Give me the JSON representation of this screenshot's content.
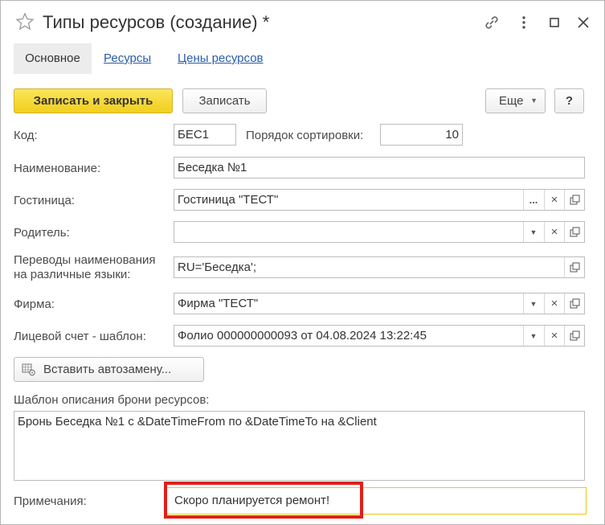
{
  "window": {
    "title": "Типы ресурсов (создание) *"
  },
  "tabs": [
    {
      "label": "Основное"
    },
    {
      "label": "Ресурсы"
    },
    {
      "label": "Цены ресурсов"
    }
  ],
  "toolbar": {
    "save_close_label": "Записать и закрыть",
    "save_label": "Записать",
    "more_label": "Еще",
    "help_label": "?"
  },
  "form": {
    "code": {
      "label": "Код:",
      "value": "БЕС1"
    },
    "sort_order": {
      "label": "Порядок сортировки:",
      "value": "10"
    },
    "name": {
      "label": "Наименование:",
      "value": "Беседка №1"
    },
    "hotel": {
      "label": "Гостиница:",
      "value": "Гостиница \"ТЕСТ\""
    },
    "parent": {
      "label": "Родитель:",
      "value": ""
    },
    "translations": {
      "label_line1": "Переводы наименования",
      "label_line2": "на различные языки:",
      "value": "RU='Беседка';"
    },
    "firm": {
      "label": "Фирма:",
      "value": "Фирма \"ТЕСТ\""
    },
    "account_template": {
      "label": "Лицевой счет - шаблон:",
      "value": "Фолио 000000000093 от 04.08.2024 13:22:45"
    },
    "insert_autoreplace_label": "Вставить автозамену...",
    "booking_template": {
      "label": "Шаблон описания брони ресурсов:",
      "value": "Бронь Беседка №1 с &DateTimeFrom по &DateTimeTo на &Client"
    },
    "notes": {
      "label": "Примечания:",
      "value": "Скоро планируется ремонт!"
    }
  },
  "colors": {
    "accent_yellow": "#f3d22b",
    "link_blue": "#2a5ca8",
    "highlight_red": "#e0201b",
    "focus_border": "#f0c419"
  }
}
